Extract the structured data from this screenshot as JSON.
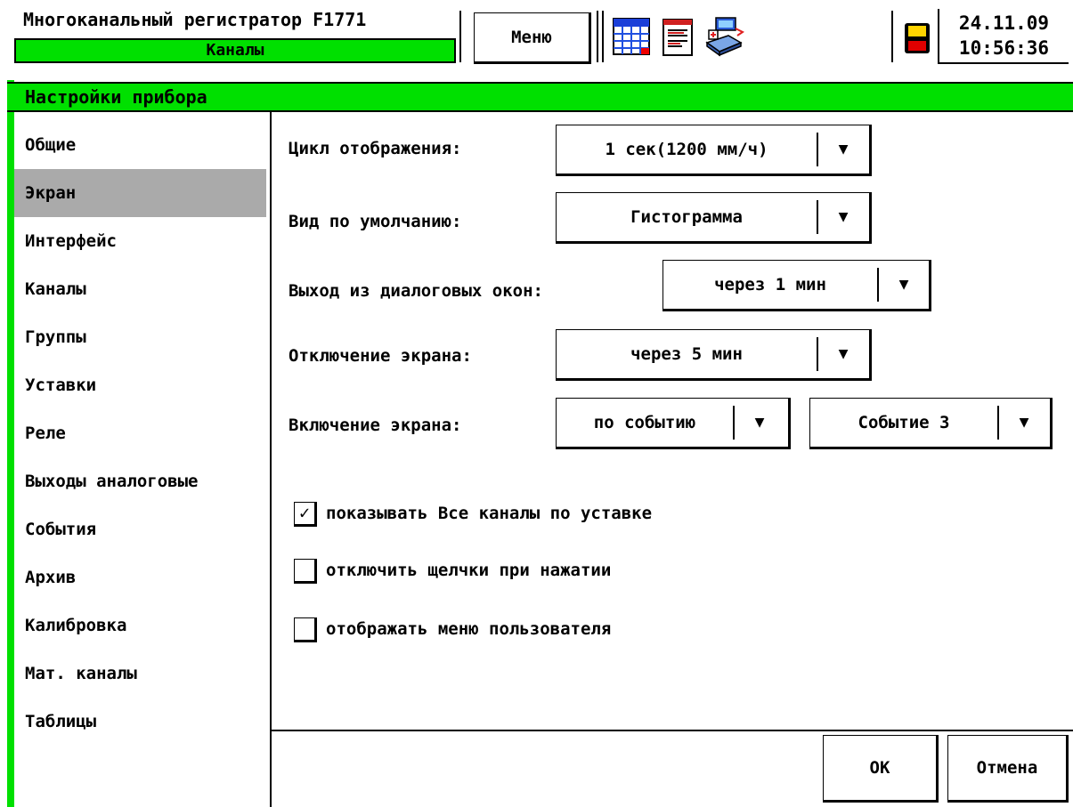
{
  "header": {
    "app_title": "Многоканальный регистратор F1771",
    "section": "Каналы",
    "menu_label": "Меню",
    "toolbar_icons": [
      "table-icon",
      "report-icon",
      "device-transfer-icon"
    ],
    "status_icon": "save-disk-icon",
    "date": "24.11.09",
    "time": "10:56:36"
  },
  "window": {
    "title": "Настройки прибора"
  },
  "sidebar": {
    "items": [
      {
        "label": "Общие"
      },
      {
        "label": "Экран",
        "active": true
      },
      {
        "label": "Интерфейс"
      },
      {
        "label": "Каналы"
      },
      {
        "label": "Группы"
      },
      {
        "label": "Уставки"
      },
      {
        "label": "Реле"
      },
      {
        "label": "Выходы аналоговые"
      },
      {
        "label": "События"
      },
      {
        "label": "Архив"
      },
      {
        "label": "Калибровка"
      },
      {
        "label": "Мат. каналы"
      },
      {
        "label": "Таблицы"
      }
    ]
  },
  "form": {
    "display_cycle": {
      "label": "Цикл отображения:",
      "value": "1 сек(1200 мм/ч)"
    },
    "default_view": {
      "label": "Вид по умолчанию:",
      "value": "Гистограмма"
    },
    "dialog_exit": {
      "label": "Выход из диалоговых окон:",
      "value": "через 1 мин"
    },
    "screen_off": {
      "label": "Отключение экрана:",
      "value": "через 5 мин"
    },
    "screen_on": {
      "label": "Включение экрана:",
      "value": "по событию",
      "event_value": "Событие 3"
    },
    "arrow": "▼",
    "checkboxes": [
      {
        "label": "показывать Все каналы по уставке",
        "checked": true
      },
      {
        "label": "отключить щелчки при нажатии",
        "checked": false
      },
      {
        "label": "отображать меню пользователя",
        "checked": false
      }
    ],
    "check_mark": "✓"
  },
  "footer": {
    "ok_label": "ОК",
    "cancel_label": "Отмена"
  },
  "colors": {
    "accent_green": "#00e000",
    "selected_gray": "#aaaaaa"
  }
}
